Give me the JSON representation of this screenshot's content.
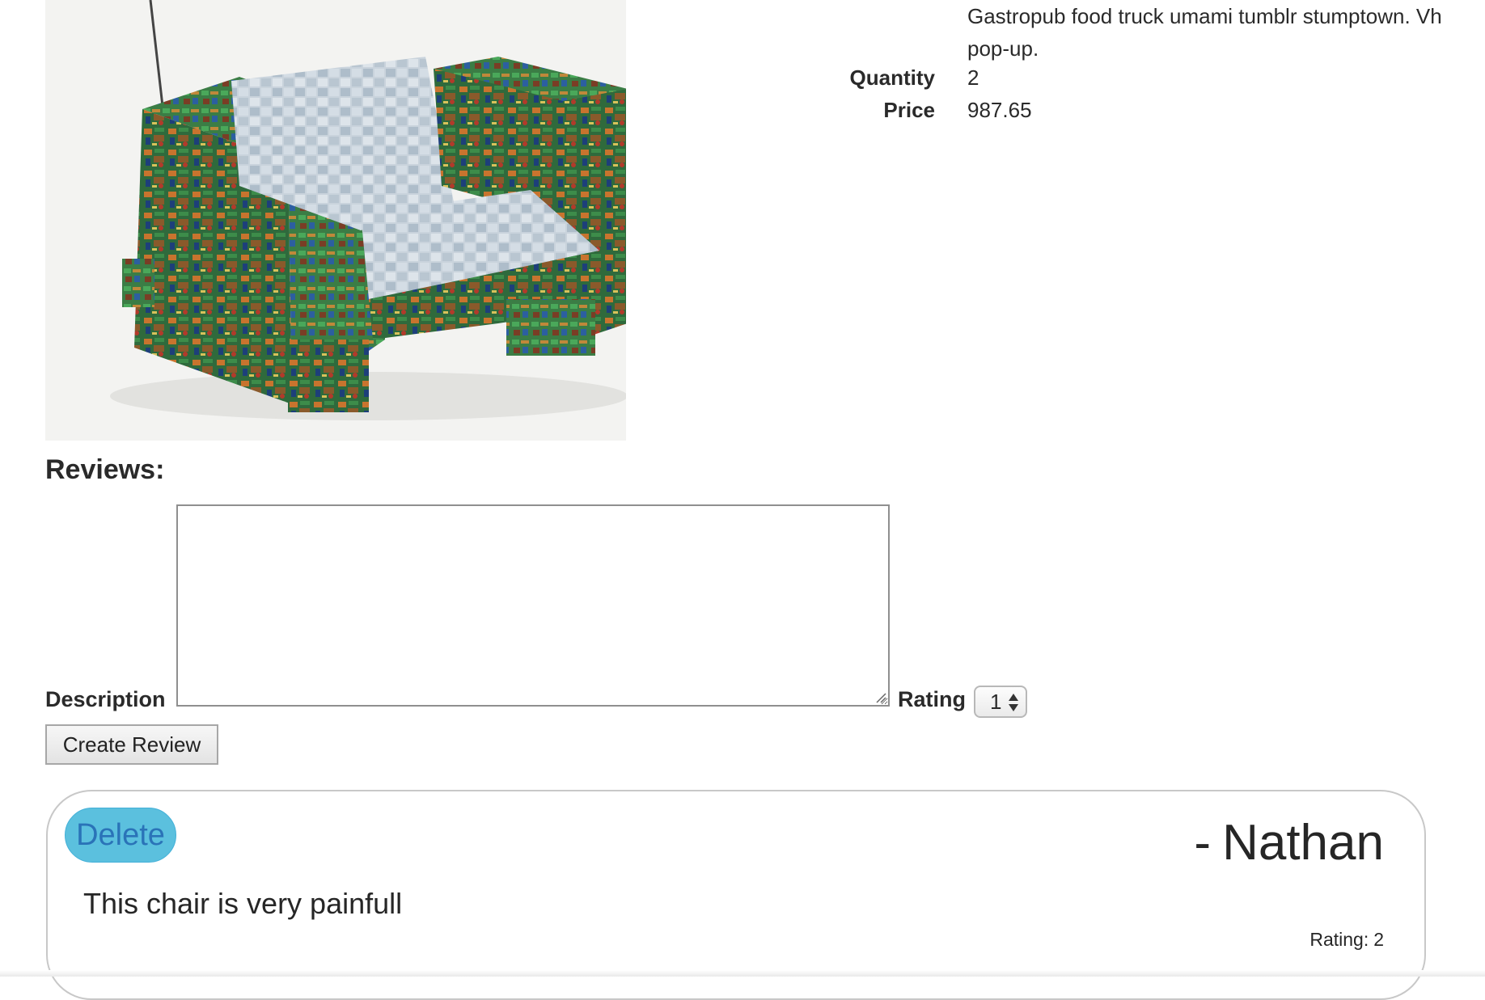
{
  "product": {
    "description_lines": [
      "Gastropub food truck umami tumblr stumptown. Vh",
      "pop-up."
    ],
    "quantity_label": "Quantity",
    "quantity_value": "2",
    "price_label": "Price",
    "price_value": "987.65"
  },
  "reviews_form": {
    "heading": "Reviews:",
    "description_label": "Description",
    "description_value": "",
    "rating_label": "Rating",
    "rating_selected": "1",
    "submit_label": "Create Review"
  },
  "reviews": [
    {
      "delete_label": "Delete",
      "author_prefix": "-",
      "author": "Nathan",
      "text": "This chair is very painfull",
      "rating_label": "Rating:",
      "rating_value": "2"
    }
  ],
  "colors": {
    "delete_button_bg": "#5bc0de",
    "delete_button_text": "#2a73b8",
    "card_border": "#c8c8c8"
  }
}
